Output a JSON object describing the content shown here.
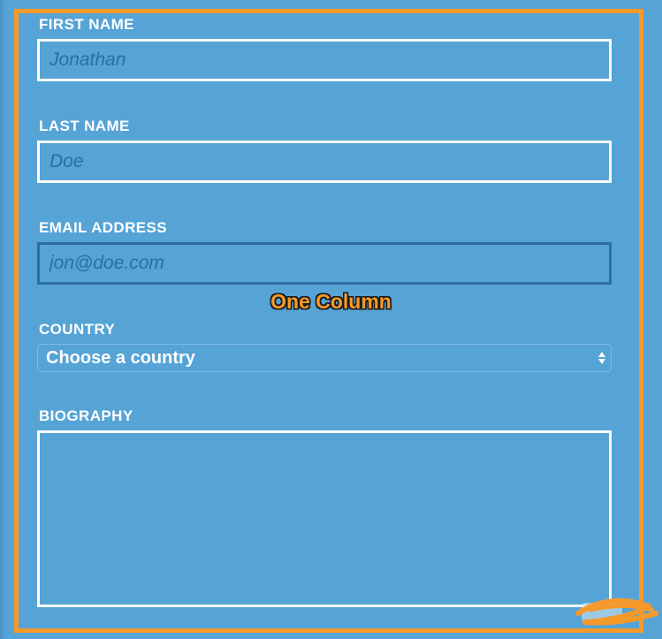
{
  "form": {
    "first_name": {
      "label": "FIRST NAME",
      "placeholder": "Jonathan"
    },
    "last_name": {
      "label": "LAST NAME",
      "placeholder": "Doe"
    },
    "email": {
      "label": "EMAIL ADDRESS",
      "placeholder": "jon@doe.com"
    },
    "country": {
      "label": "COUNTRY",
      "selected": "Choose a country"
    },
    "biography": {
      "label": "BIOGRAPHY"
    }
  },
  "annotation": {
    "caption": "One Column",
    "color": "#f59a2a"
  },
  "colors": {
    "background": "#56a3d6",
    "field_border": "#ffffff",
    "focused_border": "#2e6e9f",
    "placeholder_text": "#2a6fa3"
  }
}
